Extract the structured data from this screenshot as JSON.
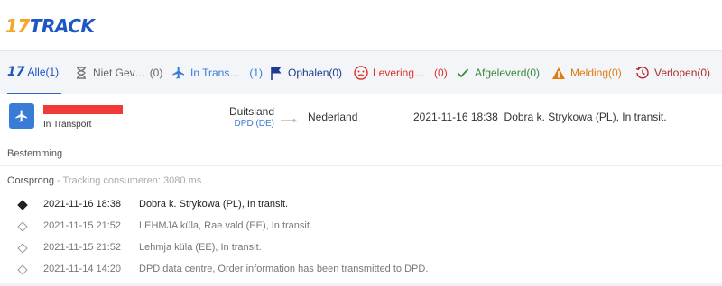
{
  "brand": {
    "logo_num": "17",
    "logo_text": "TRACK",
    "accent": "#1d57c4",
    "logo_accent": "#f5a623"
  },
  "tabs": [
    {
      "label": "Alle",
      "count": "(1)",
      "icon": "17-logo-icon",
      "active": true
    },
    {
      "label": "Niet Gev…",
      "count": "(0)",
      "icon": "hourglass-icon"
    },
    {
      "label": "In Trans…",
      "count": "(1)",
      "icon": "airplane-icon"
    },
    {
      "label": "Ophalen",
      "count": "(0)",
      "icon": "flag-icon"
    },
    {
      "label": "Levering…",
      "count": "(0)",
      "icon": "sad-face-icon"
    },
    {
      "label": "Afgeleverd",
      "count": "(0)",
      "icon": "checkmark-icon"
    },
    {
      "label": "Melding",
      "count": "(0)",
      "icon": "warning-icon"
    },
    {
      "label": "Verlopen",
      "count": "(0)",
      "icon": "expired-clock-icon"
    }
  ],
  "shipment": {
    "status": "In Transport",
    "origin_country": "Duitsland",
    "carrier": "DPD (DE)",
    "destination_country": "Nederland",
    "last_event_time": "2021-11-16 18:38",
    "last_event_desc": "Dobra k. Strykowa (PL), In transit."
  },
  "details": {
    "destination_label": "Bestemming",
    "origin_label": "Oorsprong",
    "origin_note": " - Tracking consumeren: 3080 ms",
    "events": [
      {
        "time": "2021-11-16 18:38",
        "desc": "Dobra k. Strykowa (PL), In transit."
      },
      {
        "time": "2021-11-15 21:52",
        "desc": "LEHMJA küla, Rae vald (EE), In transit."
      },
      {
        "time": "2021-11-15 21:52",
        "desc": "Lehmja küla (EE), In transit."
      },
      {
        "time": "2021-11-14 14:20",
        "desc": "DPD data centre, Order information has been transmitted to DPD."
      }
    ]
  }
}
